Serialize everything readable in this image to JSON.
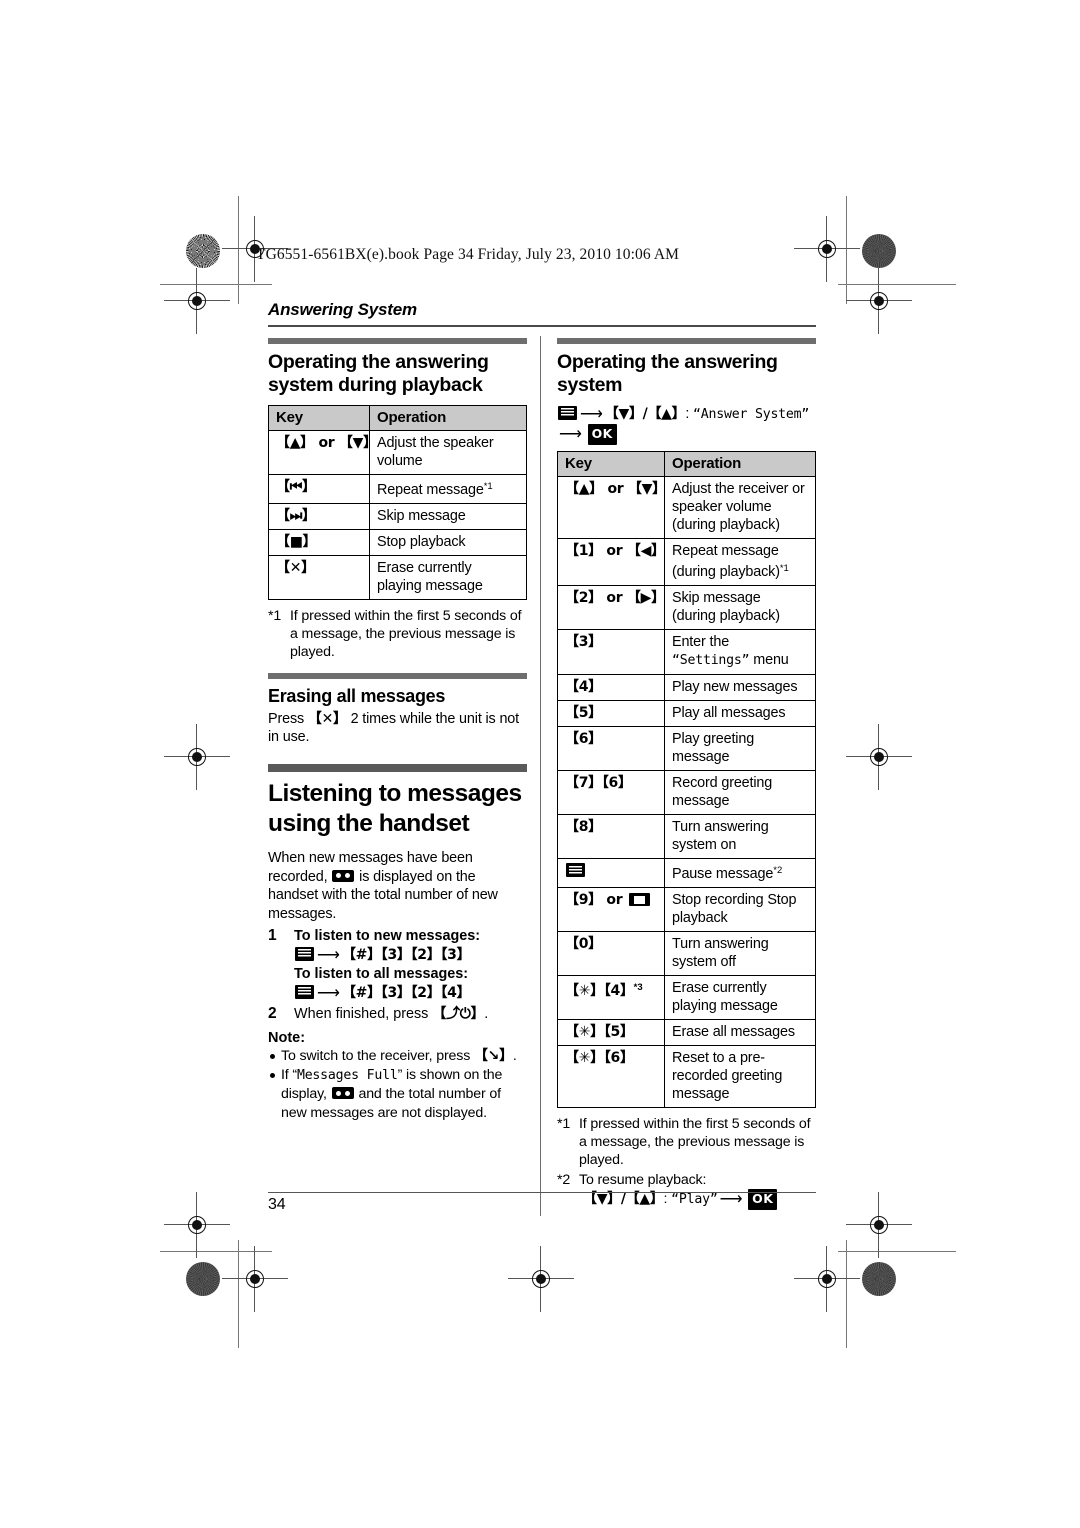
{
  "printing": {
    "book_line": "TG6551-6561BX(e).book  Page 34  Friday, July 23, 2010  10:06 AM",
    "page_number": "34"
  },
  "running_head": "Answering System",
  "left_column": {
    "section1": {
      "title": "Operating the answering system during playback",
      "table": {
        "headers": [
          "Key",
          "Operation"
        ],
        "rows": [
          {
            "key_prefix": "",
            "key_symbol": "up-down-keys",
            "key_text": "【▲】 or 【▼】",
            "operation": "Adjust the speaker volume",
            "footnote": ""
          },
          {
            "key_symbol": "rewind-key",
            "key_text": "【⏮】",
            "operation": "Repeat message",
            "footnote": "*1"
          },
          {
            "key_symbol": "skip-key",
            "key_text": "【⏭】",
            "operation": "Skip message",
            "footnote": ""
          },
          {
            "key_symbol": "stop-key",
            "key_text": "【■】",
            "operation": "Stop playback",
            "footnote": ""
          },
          {
            "key_symbol": "erase-key",
            "key_text": "【✕】",
            "operation": "Erase currently playing message",
            "footnote": ""
          }
        ]
      },
      "footnote1_mark": "*1",
      "footnote1_text": "If pressed within the first 5 seconds of a message, the previous message is played."
    },
    "section2": {
      "title": "Erasing all messages",
      "text_before": "Press ",
      "key": "【✕】",
      "text_after": " 2 times while the unit is not in use."
    },
    "section3": {
      "title": "Listening to messages using the handset",
      "intro_part1": "When new messages have been recorded, ",
      "intro_icon": "tape-icon",
      "intro_part2": " is displayed on the handset with the total number of new messages.",
      "steps": [
        {
          "num": "1",
          "line1": "To listen to new messages:",
          "line2_keys": "【#】【3】【2】【3】",
          "line3": "To listen to all messages:",
          "line4_keys": "【#】【3】【2】【4】"
        },
        {
          "num": "2",
          "text_before": "When finished, press ",
          "key": "【⤴⏻】",
          "text_after": "."
        }
      ],
      "note_label": "Note:",
      "notes": [
        {
          "before": "To switch to the receiver, press ",
          "key": "【↘】",
          "after": "."
        },
        {
          "before": "If “",
          "mono": "Messages Full",
          "mid": "” is shown on the display, ",
          "icon": "tape-icon",
          "after": " and the total number of new messages are not displayed."
        }
      ]
    }
  },
  "right_column": {
    "section1": {
      "title": "Operating the answering system",
      "nav_icon": "menu-icon",
      "nav_keys": "【▼】/【▲】",
      "nav_label": "“Answer System”",
      "nav_ok": "OK",
      "table": {
        "headers": [
          "Key",
          "Operation"
        ],
        "rows": [
          {
            "key_text": "【▲】 or 【▼】",
            "operation": "Adjust the receiver or speaker volume (during playback)",
            "footnote": ""
          },
          {
            "key_text": "【1】 or 【◀】",
            "operation": "Repeat message (during playback)",
            "footnote": "*1"
          },
          {
            "key_text": "【2】 or 【▶】",
            "operation": "Skip message (during playback)",
            "footnote": ""
          },
          {
            "key_text": "【3】",
            "operation_pre": "Enter the ",
            "operation_mono": "“Settings”",
            "operation_post": " menu",
            "footnote": ""
          },
          {
            "key_text": "【4】",
            "operation": "Play new messages",
            "footnote": ""
          },
          {
            "key_text": "【5】",
            "operation": "Play all messages",
            "footnote": ""
          },
          {
            "key_text": "【6】",
            "operation": "Play greeting message",
            "footnote": ""
          },
          {
            "key_text": "【7】【6】",
            "operation": "Record greeting message",
            "footnote": ""
          },
          {
            "key_text": "【8】",
            "operation": "Turn answering system on",
            "footnote": ""
          },
          {
            "key_symbol": "menu-icon",
            "key_text": "",
            "operation": "Pause message",
            "footnote": "*2"
          },
          {
            "key_text": "【9】 or ",
            "key_symbol2": "stop-icon",
            "operation": "Stop recording Stop playback",
            "footnote": ""
          },
          {
            "key_text": "【0】",
            "operation": "Turn answering system off",
            "footnote": ""
          },
          {
            "key_text": "【✳】【4】",
            "key_sup": "*3",
            "operation": "Erase currently playing message",
            "footnote": ""
          },
          {
            "key_text": "【✳】【5】",
            "operation": "Erase all messages",
            "footnote": ""
          },
          {
            "key_text": "【✳】【6】",
            "operation": "Reset to a pre-recorded greeting message",
            "footnote": ""
          }
        ]
      },
      "footnote1_mark": "*1",
      "footnote1_text": "If pressed within the first 5 seconds of a message, the previous message is played.",
      "footnote2_mark": "*2",
      "footnote2_text": "To resume playback:",
      "footnote2_keys": "【▼】/【▲】",
      "footnote2_label": "“Play”",
      "footnote2_ok": "OK"
    }
  }
}
